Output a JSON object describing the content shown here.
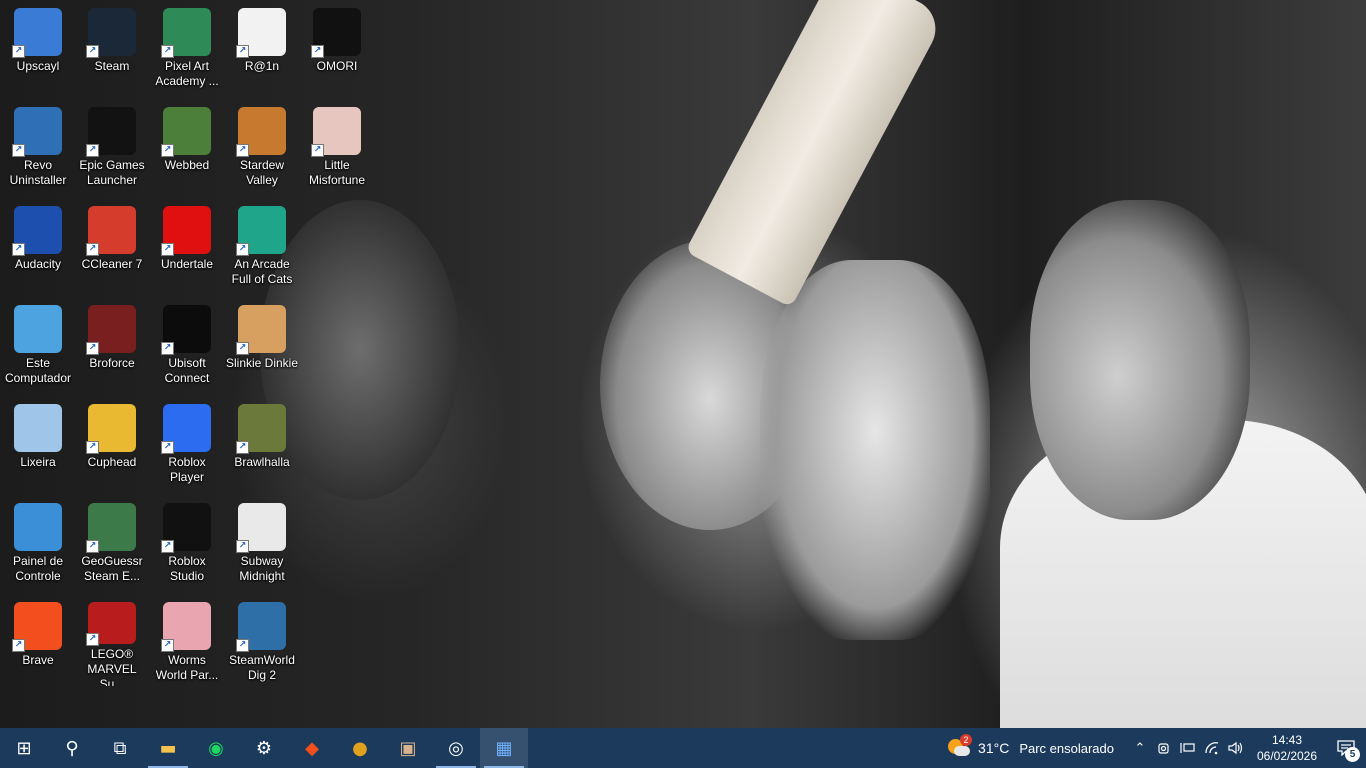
{
  "desktop_icons": [
    {
      "label": "Upscayl",
      "icon": "upscayl-icon",
      "bg": "#3a7bd5"
    },
    {
      "label": "Revo\nUninstaller",
      "icon": "revo-uninstaller-icon",
      "bg": "#2f6fb5"
    },
    {
      "label": "Audacity",
      "icon": "audacity-icon",
      "bg": "#1c4fae"
    },
    {
      "label": "Este\nComputador",
      "icon": "computer-icon",
      "bg": "#4da3e0"
    },
    {
      "label": "Lixeira",
      "icon": "recycle-bin-icon",
      "bg": "#9fc6e8"
    },
    {
      "label": "Painel de\nControle",
      "icon": "control-panel-icon",
      "bg": "#3b8fd6"
    },
    {
      "label": "Brave",
      "icon": "brave-icon",
      "bg": "#f24e1e"
    },
    {
      "label": "Steam",
      "icon": "steam-icon",
      "bg": "#1b2838"
    },
    {
      "label": "Epic Games\nLauncher",
      "icon": "epic-games-icon",
      "bg": "#121212"
    },
    {
      "label": "CCleaner 7",
      "icon": "ccleaner-icon",
      "bg": "#d63c2c"
    },
    {
      "label": "Broforce",
      "icon": "broforce-icon",
      "bg": "#7a1f1f"
    },
    {
      "label": "Cuphead",
      "icon": "cuphead-icon",
      "bg": "#e8b931"
    },
    {
      "label": "GeoGuessr\nSteam E...",
      "icon": "geoguessr-icon",
      "bg": "#3d7a4a"
    },
    {
      "label": "LEGO®\nMARVEL Su...",
      "icon": "lego-marvel-icon",
      "bg": "#b81c1c"
    },
    {
      "label": "Pixel Art\nAcademy ...",
      "icon": "pixel-art-academy-icon",
      "bg": "#2e8b57"
    },
    {
      "label": "Webbed",
      "icon": "webbed-icon",
      "bg": "#4b7f3a"
    },
    {
      "label": "Undertale",
      "icon": "undertale-heart-icon",
      "bg": "#e01010"
    },
    {
      "label": "Ubisoft\nConnect",
      "icon": "ubisoft-connect-icon",
      "bg": "#0c0c0c"
    },
    {
      "label": "Roblox\nPlayer",
      "icon": "roblox-player-icon",
      "bg": "#2b6cf0"
    },
    {
      "label": "Roblox\nStudio",
      "icon": "roblox-studio-icon",
      "bg": "#111111"
    },
    {
      "label": "Worms\nWorld Par...",
      "icon": "worms-icon",
      "bg": "#e9a6b0"
    },
    {
      "label": "R@1n",
      "icon": "text-file-icon",
      "bg": "#f2f2f2"
    },
    {
      "label": "Stardew\nValley",
      "icon": "stardew-valley-icon",
      "bg": "#c77a2f"
    },
    {
      "label": "An Arcade\nFull of Cats",
      "icon": "arcade-cats-icon",
      "bg": "#1fa58a"
    },
    {
      "label": "Slinkie Dinkie",
      "icon": "slinkie-dinkie-icon",
      "bg": "#d8a060"
    },
    {
      "label": "Brawlhalla",
      "icon": "brawlhalla-icon",
      "bg": "#6b7a3a"
    },
    {
      "label": "Subway\nMidnight",
      "icon": "subway-midnight-icon",
      "bg": "#e9e9e9"
    },
    {
      "label": "SteamWorld\nDig 2",
      "icon": "steamworld-dig-icon",
      "bg": "#2e6fa8"
    },
    {
      "label": "OMORI",
      "icon": "omori-icon",
      "bg": "#111111"
    },
    {
      "label": "Little\nMisfortune",
      "icon": "little-misfortune-icon",
      "bg": "#e8c6c0"
    }
  ],
  "taskbar": {
    "apps": [
      {
        "name": "start-button-icon",
        "glyph": "⊞"
      },
      {
        "name": "search-icon",
        "glyph": "⚲"
      },
      {
        "name": "task-view-icon",
        "glyph": "⧉"
      },
      {
        "name": "file-explorer-icon",
        "glyph": "▬"
      },
      {
        "name": "spotify-icon",
        "glyph": "◉"
      },
      {
        "name": "settings-gear-icon",
        "glyph": "⚙"
      },
      {
        "name": "brave-icon",
        "glyph": "◆"
      },
      {
        "name": "taskbar-game-icon",
        "glyph": "●"
      },
      {
        "name": "taskbar-app-icon",
        "glyph": "▣"
      },
      {
        "name": "steam-icon",
        "glyph": "◎"
      },
      {
        "name": "upscayl-icon",
        "glyph": "▦"
      }
    ],
    "weather": {
      "badge": "2",
      "temp": "31°C",
      "condition": "Parc ensolarado"
    },
    "tray": {
      "chevron": "⌃",
      "icons": [
        "meet-now-icon",
        "network-icon",
        "wifi-icon",
        "volume-icon"
      ],
      "time": "14:43",
      "date": "06/02/2026",
      "notifications": "5"
    }
  },
  "colors": {
    "taskbar": "#1b3a5c",
    "accent": "#8fb8e6"
  }
}
